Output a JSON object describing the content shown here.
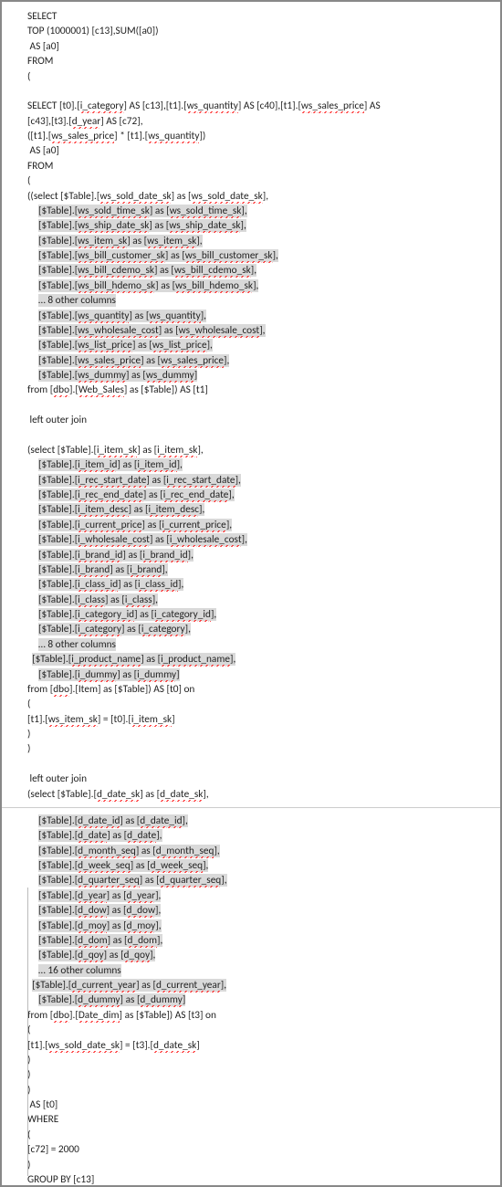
{
  "sql": {
    "l1": "SELECT",
    "l2_a": "TOP (1000001) [c13],SUM([a0])",
    "l3": " AS [a0]",
    "l4": "FROM",
    "l5": "(",
    "blank1": "",
    "l7_a": "SELECT [t0].[",
    "l7_b": "i_category",
    "l7_c": "] AS [c13],[t1].[",
    "l7_d": "ws_quantity",
    "l7_e": "] AS [c40],[t1].[",
    "l7_f": "ws_sales_price",
    "l7_g": "] AS",
    "l8_a": "[c43],[t3].[",
    "l8_b": "d_year",
    "l8_c": "] AS [c72],",
    "l9_a": "([t1].[",
    "l9_b": "ws_sales_price",
    "l9_c": "] * [t1].[",
    "l9_d": "ws_quantity",
    "l9_e": "])",
    "l10": " AS [a0]",
    "l11": "FROM",
    "l12": "(",
    "l13_a": "((select [$Table].[",
    "l13_b": "ws_sold_date_sk",
    "l13_c": "] as [",
    "l13_d": "ws_sold_date_sk",
    "l13_e": "],",
    "col_ws_sold_time": "ws_sold_time_sk",
    "col_ws_ship_date": "ws_ship_date_sk",
    "col_ws_item": "ws_item_sk",
    "col_ws_bill_cust": "ws_bill_customer_sk",
    "col_ws_bill_cdemo": "ws_bill_cdemo_sk",
    "col_ws_bill_hdemo": "ws_bill_hdemo_sk",
    "ell8": "… 8 other columns",
    "col_ws_quantity": "ws_quantity",
    "col_ws_wholesale": "ws_wholesale_cost",
    "col_ws_list_price": "ws_list_price",
    "col_ws_sales_price": "ws_sales_price",
    "col_ws_dummy": "ws_dummy",
    "from1_a": "from [",
    "from1_b": "dbo",
    "from1_c": "].[",
    "from1_d": "Web_Sales",
    "from1_e": "] as [$Table]) AS [t1]",
    "loj1": " left outer join",
    "sel2_a": "(select [$Table].[",
    "col_i_item_sk": "i_item_sk",
    "col_i_item_id": "i_item_id",
    "col_i_rec_start": "i_rec_start_date",
    "col_i_rec_end": "i_rec_end_date",
    "col_i_item_desc": "i_item_desc",
    "col_i_current_price": "i_current_price",
    "col_i_wholesale": "i_wholesale_cost",
    "col_i_brand_id": "i_brand_id",
    "col_i_brand": "i_brand",
    "col_i_class_id": "i_class_id",
    "col_i_class": "i_class",
    "col_i_category_id": "i_category_id",
    "col_i_category": "i_category",
    "ell8b": "… 8 other columns",
    "col_i_product_name": "i_product_name",
    "col_i_dummy": "i_dummy",
    "from2_d": "Item",
    "from2_e": "] as [$Table]) AS [t0] on",
    "on_open": "(",
    "join1_a": "[t1].[",
    "join1_b": "ws_item_sk",
    "join1_c": "] = [t0].[",
    "join1_d": "i_item_sk",
    "join1_e": "]",
    "cp": ")",
    "loj2": " left outer join",
    "sel3_a": "(select [$Table].[",
    "col_d_date_sk": "d_date_sk",
    "col_d_date_id": "d_date_id",
    "col_d_date": "d_date",
    "col_d_month_seq": "d_month_seq",
    "col_d_week_seq": "d_week_seq",
    "col_d_quarter_seq": "d_quarter_seq",
    "col_d_year": "d_year",
    "col_d_dow": "d_dow",
    "col_d_moy": "d_moy",
    "col_d_dom": "d_dom",
    "col_d_qoy": "d_qoy",
    "ell16": "… 16 other columns",
    "col_d_current_year": "d_current_year",
    "col_d_dummy": "d_dummy",
    "from3_d": "Date_dim",
    "from3_e": "] as [$Table]) AS [t3] on",
    "join2_b": "ws_sold_date_sk",
    "join2_d": "d_date_sk",
    "as_t0": " AS [t0]",
    "where": "WHERE",
    "cond": "[c72] = 2000",
    "groupby": "GROUP BY [c13]",
    "tbl_open": "[$Table].[",
    "as_open": "] as [",
    "close_comma": "],",
    "close_brack": "]"
  }
}
